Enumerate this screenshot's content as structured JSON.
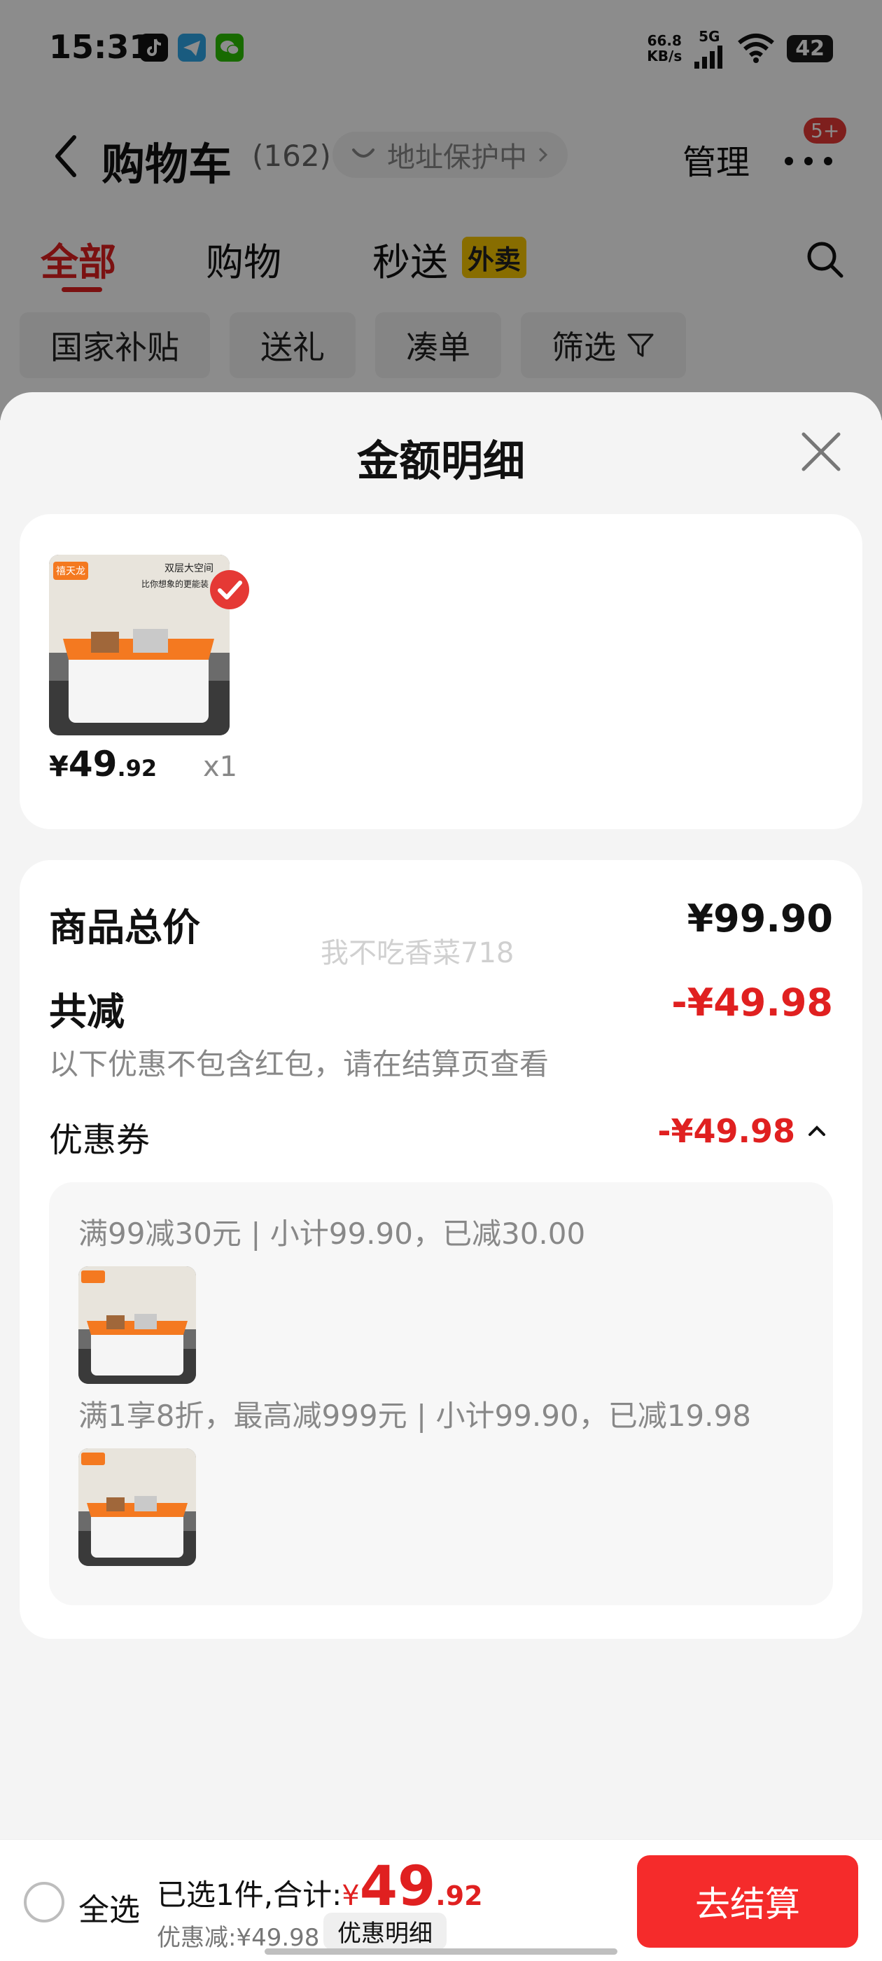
{
  "status_bar": {
    "time": "15:31",
    "apps": [
      "tiktok-icon",
      "telegram-icon",
      "wechat-icon"
    ],
    "net_speed_value": "66.8",
    "net_speed_unit": "KB/s",
    "network": "5G",
    "battery": "42"
  },
  "nav": {
    "title": "购物车",
    "count": "(162)",
    "address_protect": "地址保护中",
    "manage": "管理",
    "more_badge": "5+"
  },
  "tabs": [
    {
      "label": "全部",
      "active": true
    },
    {
      "label": "购物",
      "active": false
    },
    {
      "label": "秒送",
      "active": false
    }
  ],
  "tab_tag": "外卖",
  "filters": [
    "国家补贴",
    "送礼",
    "凑单",
    "筛选"
  ],
  "sheet": {
    "title": "金额明细",
    "product": {
      "brand": "禧天龙",
      "image_caption_1": "双层大空间",
      "image_caption_2": "比你想象的更能装",
      "price_yen": "¥",
      "price_int": "49",
      "price_dec": ".92",
      "qty": "x1"
    },
    "total_label": "商品总价",
    "total_value": "¥99.90",
    "watermark": "我不吃香菜718",
    "minus_label": "共减",
    "minus_value": "-¥49.98",
    "minus_note": "以下优惠不包含红包，请在结算页查看",
    "coupon_label": "优惠券",
    "coupon_value": "-¥49.98",
    "coupons": [
      {
        "text": "满99减30元 | 小计99.90，已减30.00"
      },
      {
        "text": "满1享8折，最高减999元 | 小计99.90，已减19.98"
      }
    ]
  },
  "bottom": {
    "select_all": "全选",
    "selected_text": "已选1件,合计:",
    "sum_yen": "¥",
    "sum_int": "49",
    "sum_dec": ".92",
    "discount": "优惠减:¥49.98",
    "detail_button": "优惠明细",
    "checkout": "去结算"
  },
  "colors": {
    "accent_red": "#e02020",
    "checkout_red": "#f52b2b",
    "tag_yellow": "#f7c600",
    "product_orange": "#f47920"
  }
}
